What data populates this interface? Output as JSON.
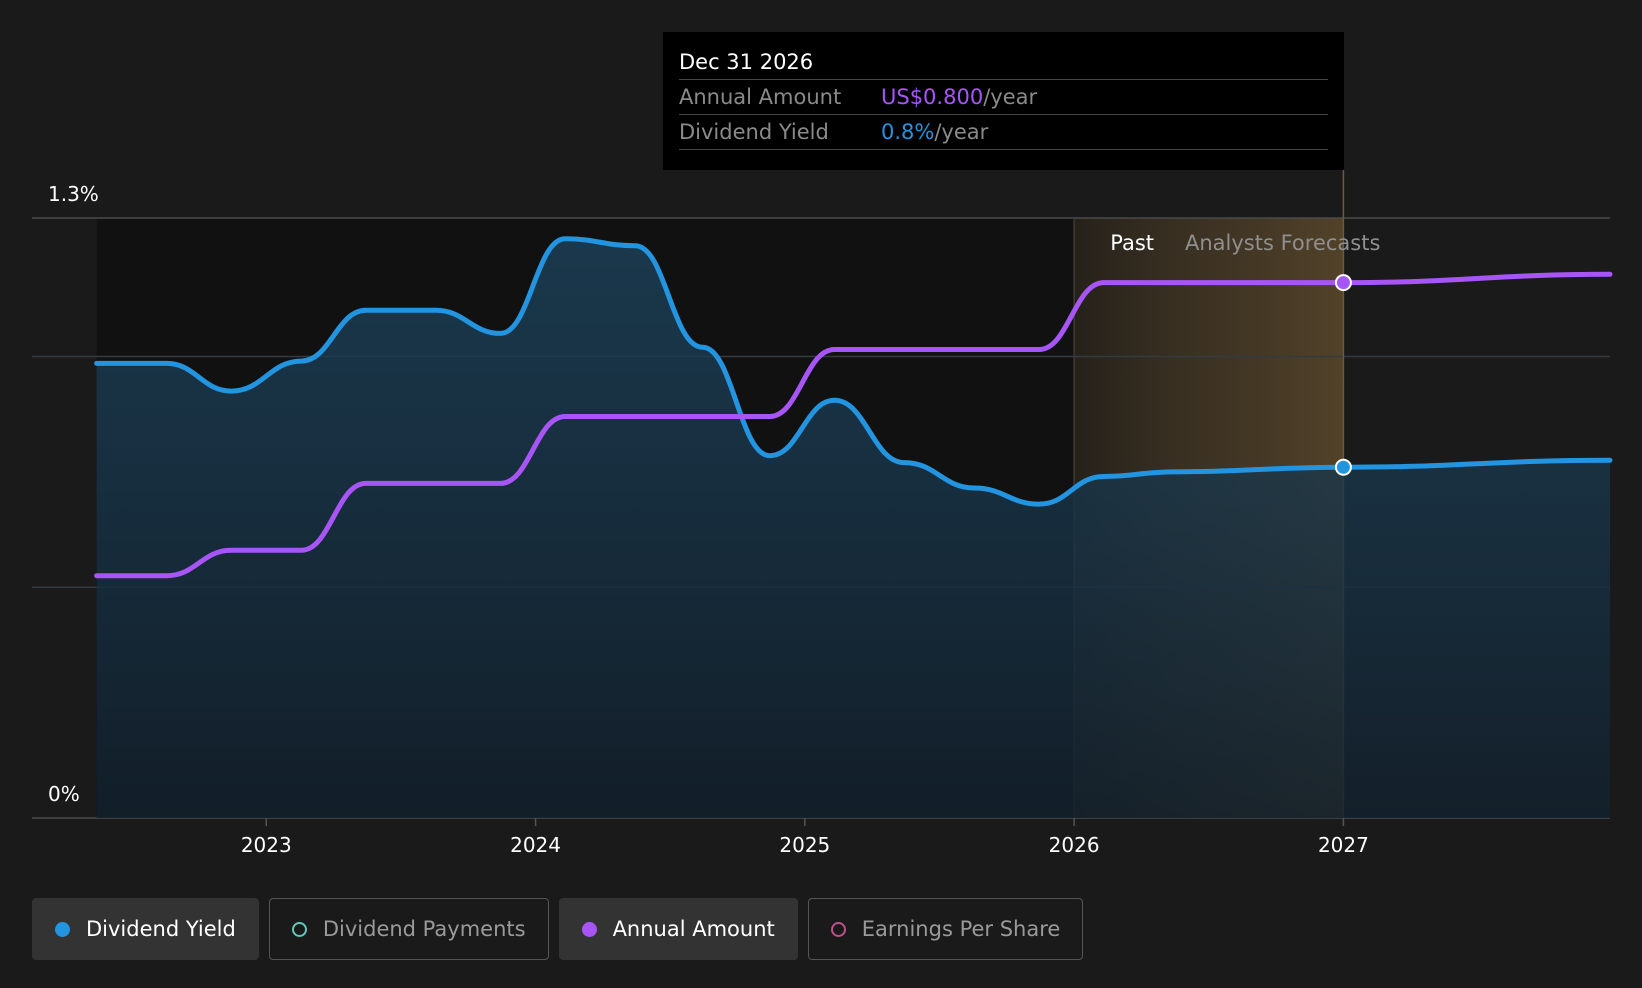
{
  "tooltip": {
    "date": "Dec 31 2026",
    "rows": [
      {
        "label": "Annual Amount",
        "value": "US$0.800",
        "unit": "/year"
      },
      {
        "label": "Dividend Yield",
        "value": "0.8%",
        "unit": "/year"
      }
    ]
  },
  "legend": [
    {
      "label": "Dividend Yield",
      "color": "#2394df",
      "active": true,
      "filled": true
    },
    {
      "label": "Dividend Payments",
      "color": "#5ec9b9",
      "active": false,
      "filled": false
    },
    {
      "label": "Annual Amount",
      "color": "#a855f7",
      "active": true,
      "filled": true
    },
    {
      "label": "Earnings Per Share",
      "color": "#c04f8a",
      "active": false,
      "filled": false
    }
  ],
  "chart_data": {
    "type": "line",
    "y_tick_labels": [
      "1.3%",
      "0%"
    ],
    "x_tick_labels": [
      "2023",
      "2024",
      "2025",
      "2026",
      "2027"
    ],
    "x_ticks": [
      2023,
      2024,
      2025,
      2026,
      2027
    ],
    "xlim": [
      2022.13,
      2027.99
    ],
    "ylim": [
      0,
      1.3
    ],
    "region_labels": {
      "past": "Past",
      "forecast": "Analysts Forecasts"
    },
    "forecast_start": 2026.0,
    "forecast_end": 2027.0,
    "grid": true,
    "series": [
      {
        "name": "Dividend Yield",
        "color": "#2394df",
        "fill": true,
        "marker_at": 2027.0,
        "points": [
          [
            2022.37,
            0.985
          ],
          [
            2022.63,
            0.985
          ],
          [
            2022.87,
            0.925
          ],
          [
            2023.13,
            0.99
          ],
          [
            2023.37,
            1.1
          ],
          [
            2023.63,
            1.1
          ],
          [
            2023.87,
            1.05
          ],
          [
            2024.11,
            1.255
          ],
          [
            2024.37,
            1.24
          ],
          [
            2024.62,
            1.02
          ],
          [
            2024.87,
            0.785
          ],
          [
            2025.11,
            0.905
          ],
          [
            2025.37,
            0.77
          ],
          [
            2025.63,
            0.715
          ],
          [
            2025.87,
            0.68
          ],
          [
            2026.11,
            0.74
          ],
          [
            2026.37,
            0.75
          ],
          [
            2027.0,
            0.76
          ],
          [
            2027.99,
            0.775
          ]
        ]
      },
      {
        "name": "Annual Amount",
        "color": "#a855f7",
        "fill": false,
        "marker_at": 2027.0,
        "points": [
          [
            2022.37,
            0.525
          ],
          [
            2022.63,
            0.525
          ],
          [
            2022.87,
            0.58
          ],
          [
            2023.13,
            0.58
          ],
          [
            2023.37,
            0.725
          ],
          [
            2023.63,
            0.725
          ],
          [
            2023.87,
            0.725
          ],
          [
            2024.11,
            0.87
          ],
          [
            2024.37,
            0.87
          ],
          [
            2024.62,
            0.87
          ],
          [
            2024.87,
            0.87
          ],
          [
            2025.11,
            1.015
          ],
          [
            2025.37,
            1.015
          ],
          [
            2025.63,
            1.015
          ],
          [
            2025.87,
            1.015
          ],
          [
            2026.11,
            1.16
          ],
          [
            2026.37,
            1.16
          ],
          [
            2027.0,
            1.16
          ],
          [
            2027.99,
            1.178
          ]
        ]
      }
    ]
  }
}
